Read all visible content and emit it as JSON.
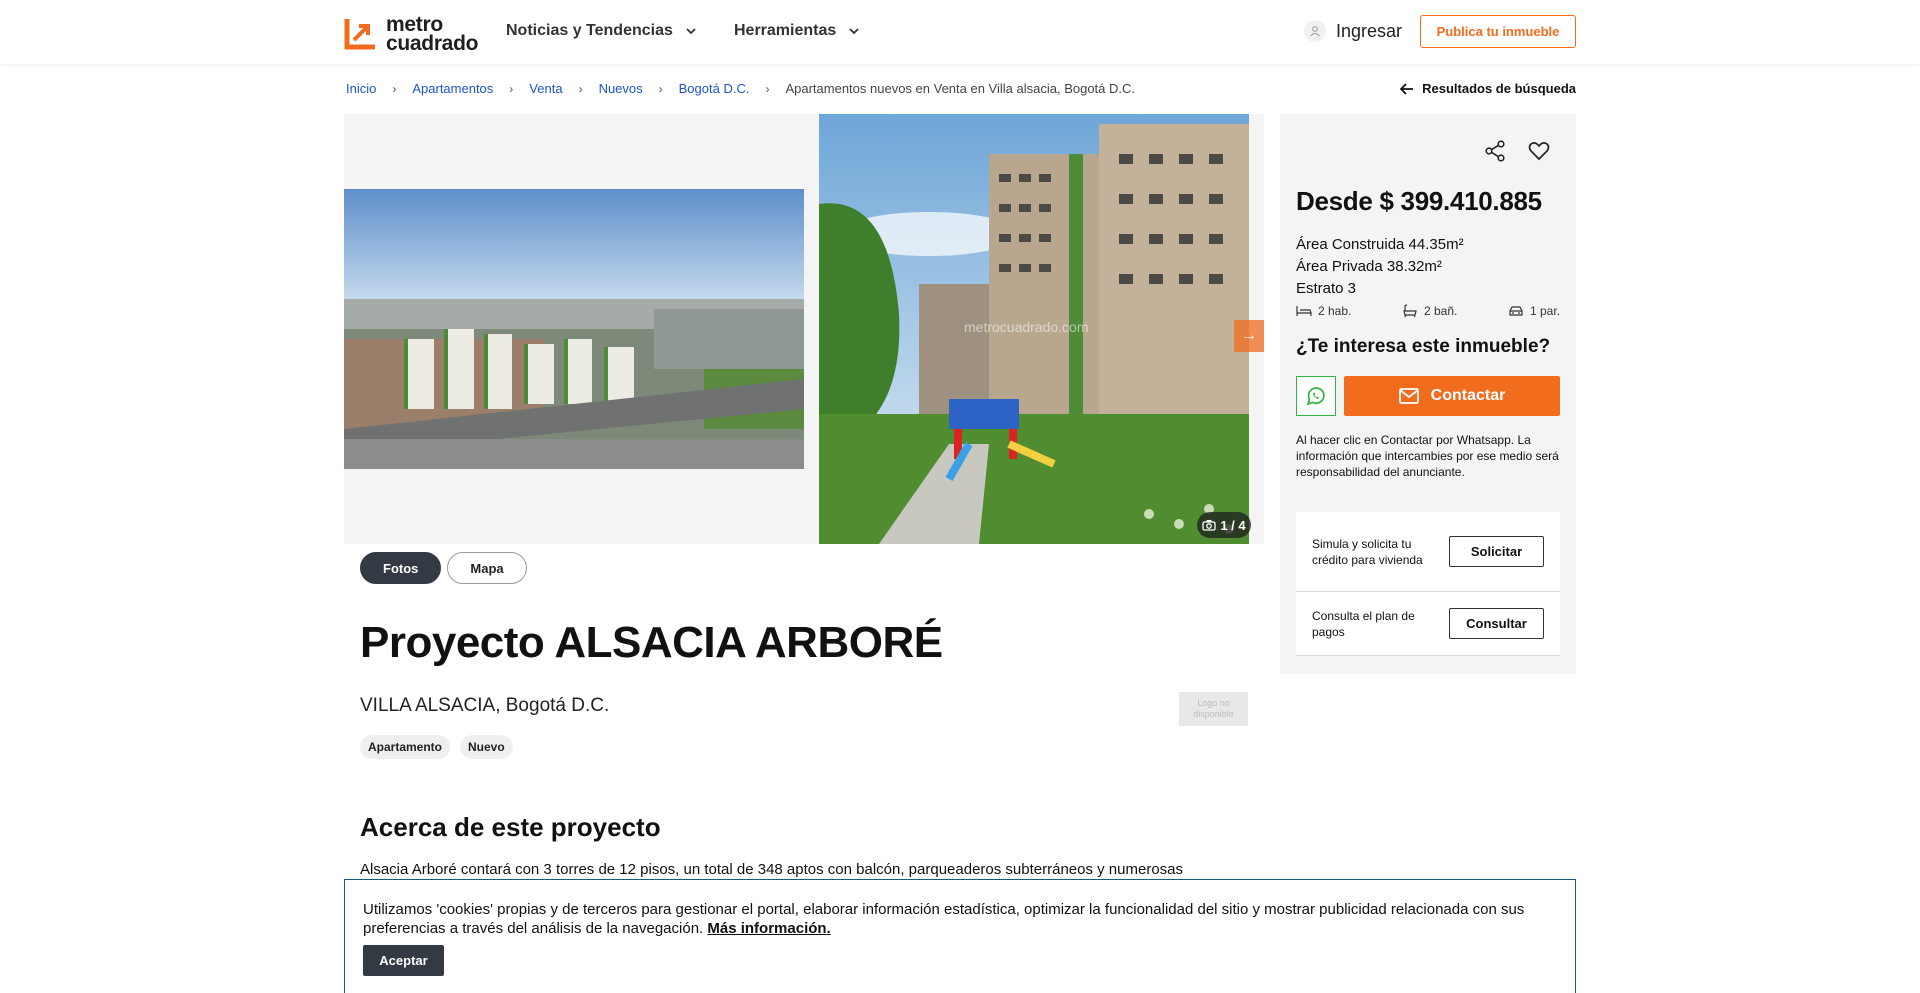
{
  "header": {
    "logo_line1": "metro",
    "logo_line2": "cuadrado",
    "nav": [
      "Noticias y Tendencias",
      "Herramientas"
    ],
    "login_label": "Ingresar",
    "publish_label": "Publica tu inmueble",
    "brand_color": "#f26c1e"
  },
  "breadcrumb": {
    "items": [
      "Inicio",
      "Apartamentos",
      "Venta",
      "Nuevos",
      "Bogotá D.C."
    ],
    "current": "Apartamentos nuevos en Venta en Villa alsacia, Bogotá D.C.",
    "back_label": "Resultados de búsqueda"
  },
  "gallery": {
    "watermark": "metrocuadrado.com",
    "counter": "1 / 4",
    "tabs": [
      "Fotos",
      "Mapa"
    ],
    "active_tab": "Fotos"
  },
  "project": {
    "title": "Proyecto ALSACIA ARBORÉ",
    "location": "VILLA ALSACIA, Bogotá D.C.",
    "logo_placeholder": "Logo no disponible",
    "chips": [
      "Apartamento",
      "Nuevo"
    ],
    "about_title": "Acerca de este proyecto",
    "about_text": "Alsacia Arboré contará con 3 torres de 12 pisos, un total de 348 aptos con balcón, parqueaderos subterráneos y numerosas"
  },
  "sidebar": {
    "price": "Desde $ 399.410.885",
    "area_built": "Área Construida 44.35m²",
    "area_private": "Área Privada 38.32m²",
    "estrato": "Estrato 3",
    "rooms": "2 hab.",
    "baths": "2 bañ.",
    "parking": "1 par.",
    "interest": "¿Te interesa este inmueble?",
    "contact_label": "Contactar",
    "disclaimer": "Al hacer clic en Contactar por Whatsapp. La información que intercambies por ese medio será responsabilidad del anunciante.",
    "cards": [
      {
        "text": "Simula y solicita tu crédito para vivienda",
        "button": "Solicitar"
      },
      {
        "text": "Consulta el plan de pagos",
        "button": "Consultar"
      }
    ]
  },
  "cookie": {
    "text": "Utilizamos 'cookies' propias y de terceros para gestionar el portal, elaborar información estadística, optimizar la funcionalidad del sitio y mostrar publicidad relacionada con sus preferencias a través del análisis de la navegación.",
    "link": "Más información.",
    "accept": "Aceptar"
  }
}
